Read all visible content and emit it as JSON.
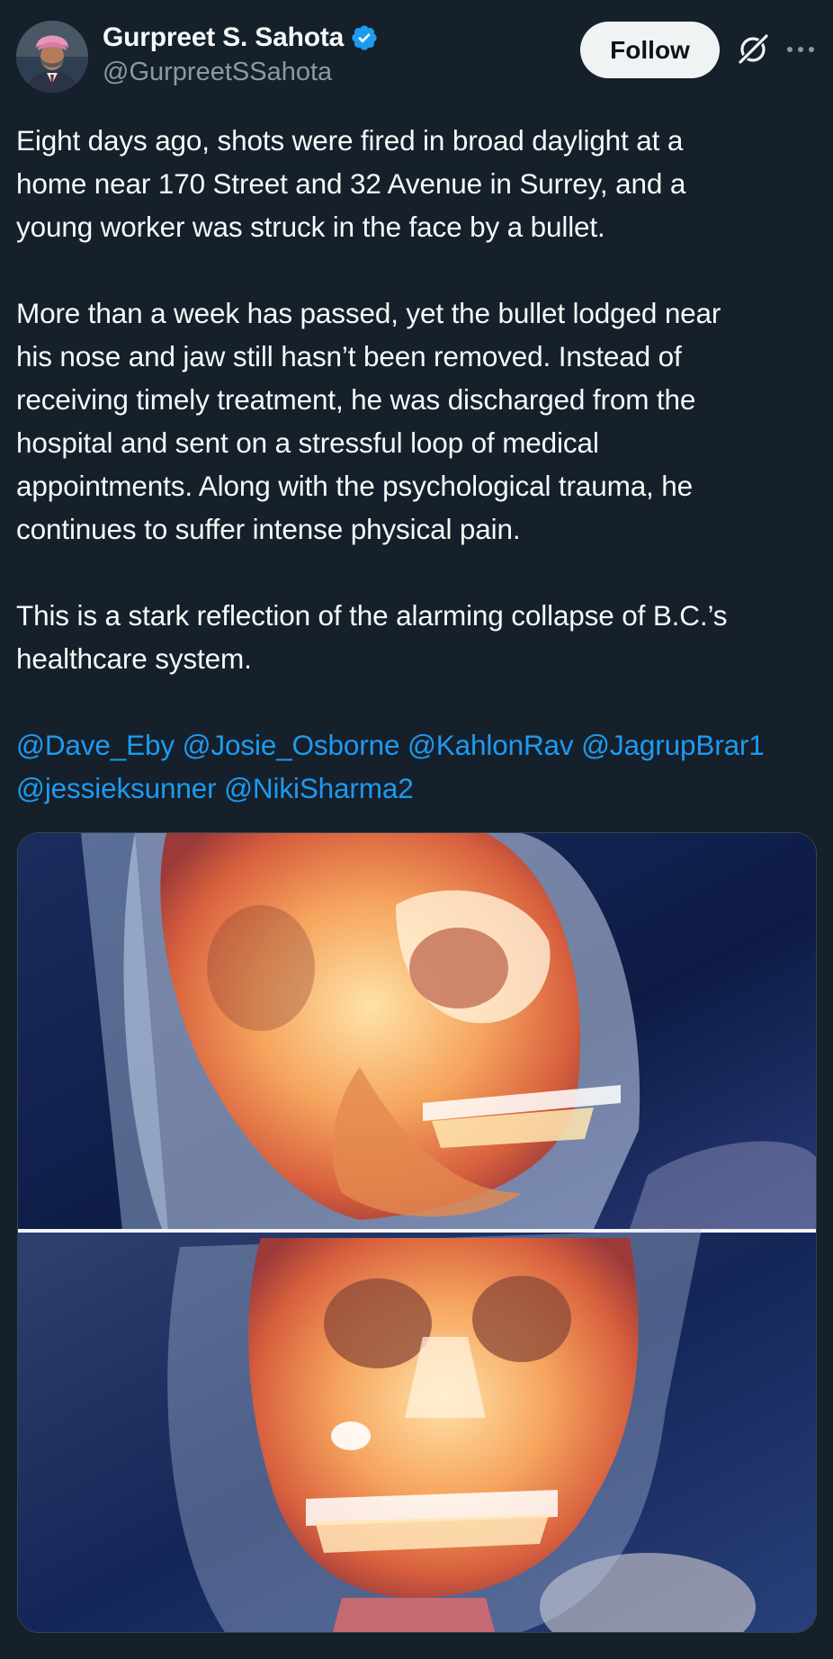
{
  "author": {
    "display_name": "Gurpreet S. Sahota",
    "handle": "@GurpreetSSahota",
    "verified": true,
    "avatar_icon": "profile-photo"
  },
  "actions": {
    "follow_label": "Follow",
    "grok_icon": "grok-icon",
    "more_icon": "more-options-icon"
  },
  "tweet": {
    "paragraphs": [
      "Eight days ago, shots were fired in broad daylight at a\nhome near 170 Street and 32 Avenue in Surrey, and a\nyoung worker was struck in the face by a bullet.",
      "More than a week has passed, yet the bullet lodged near\nhis nose and jaw still hasn’t been removed. Instead of\nreceiving timely treatment, he was discharged from the\nhospital and sent on a stressful loop of medical\nappointments. Along with the psychological trauma, he\ncontinues to suffer intense physical pain.",
      "This is a stark reflection of the alarming collapse of B.C.’s\nhealthcare system."
    ],
    "mentions": [
      "@Dave_Eby",
      "@Josie_Osborne",
      "@KahlonRav",
      "@JagrupBrar1",
      "@jessieksunner",
      "@NikiSharma2"
    ]
  },
  "media": {
    "images": [
      "ct-scan-side-view",
      "ct-scan-front-view"
    ]
  },
  "colors": {
    "background": "#15202b",
    "text": "#f7f9f9",
    "secondary_text": "#8b98a5",
    "link": "#1d9bf0",
    "verified": "#1d9bf0",
    "follow_bg": "#eff3f4"
  }
}
